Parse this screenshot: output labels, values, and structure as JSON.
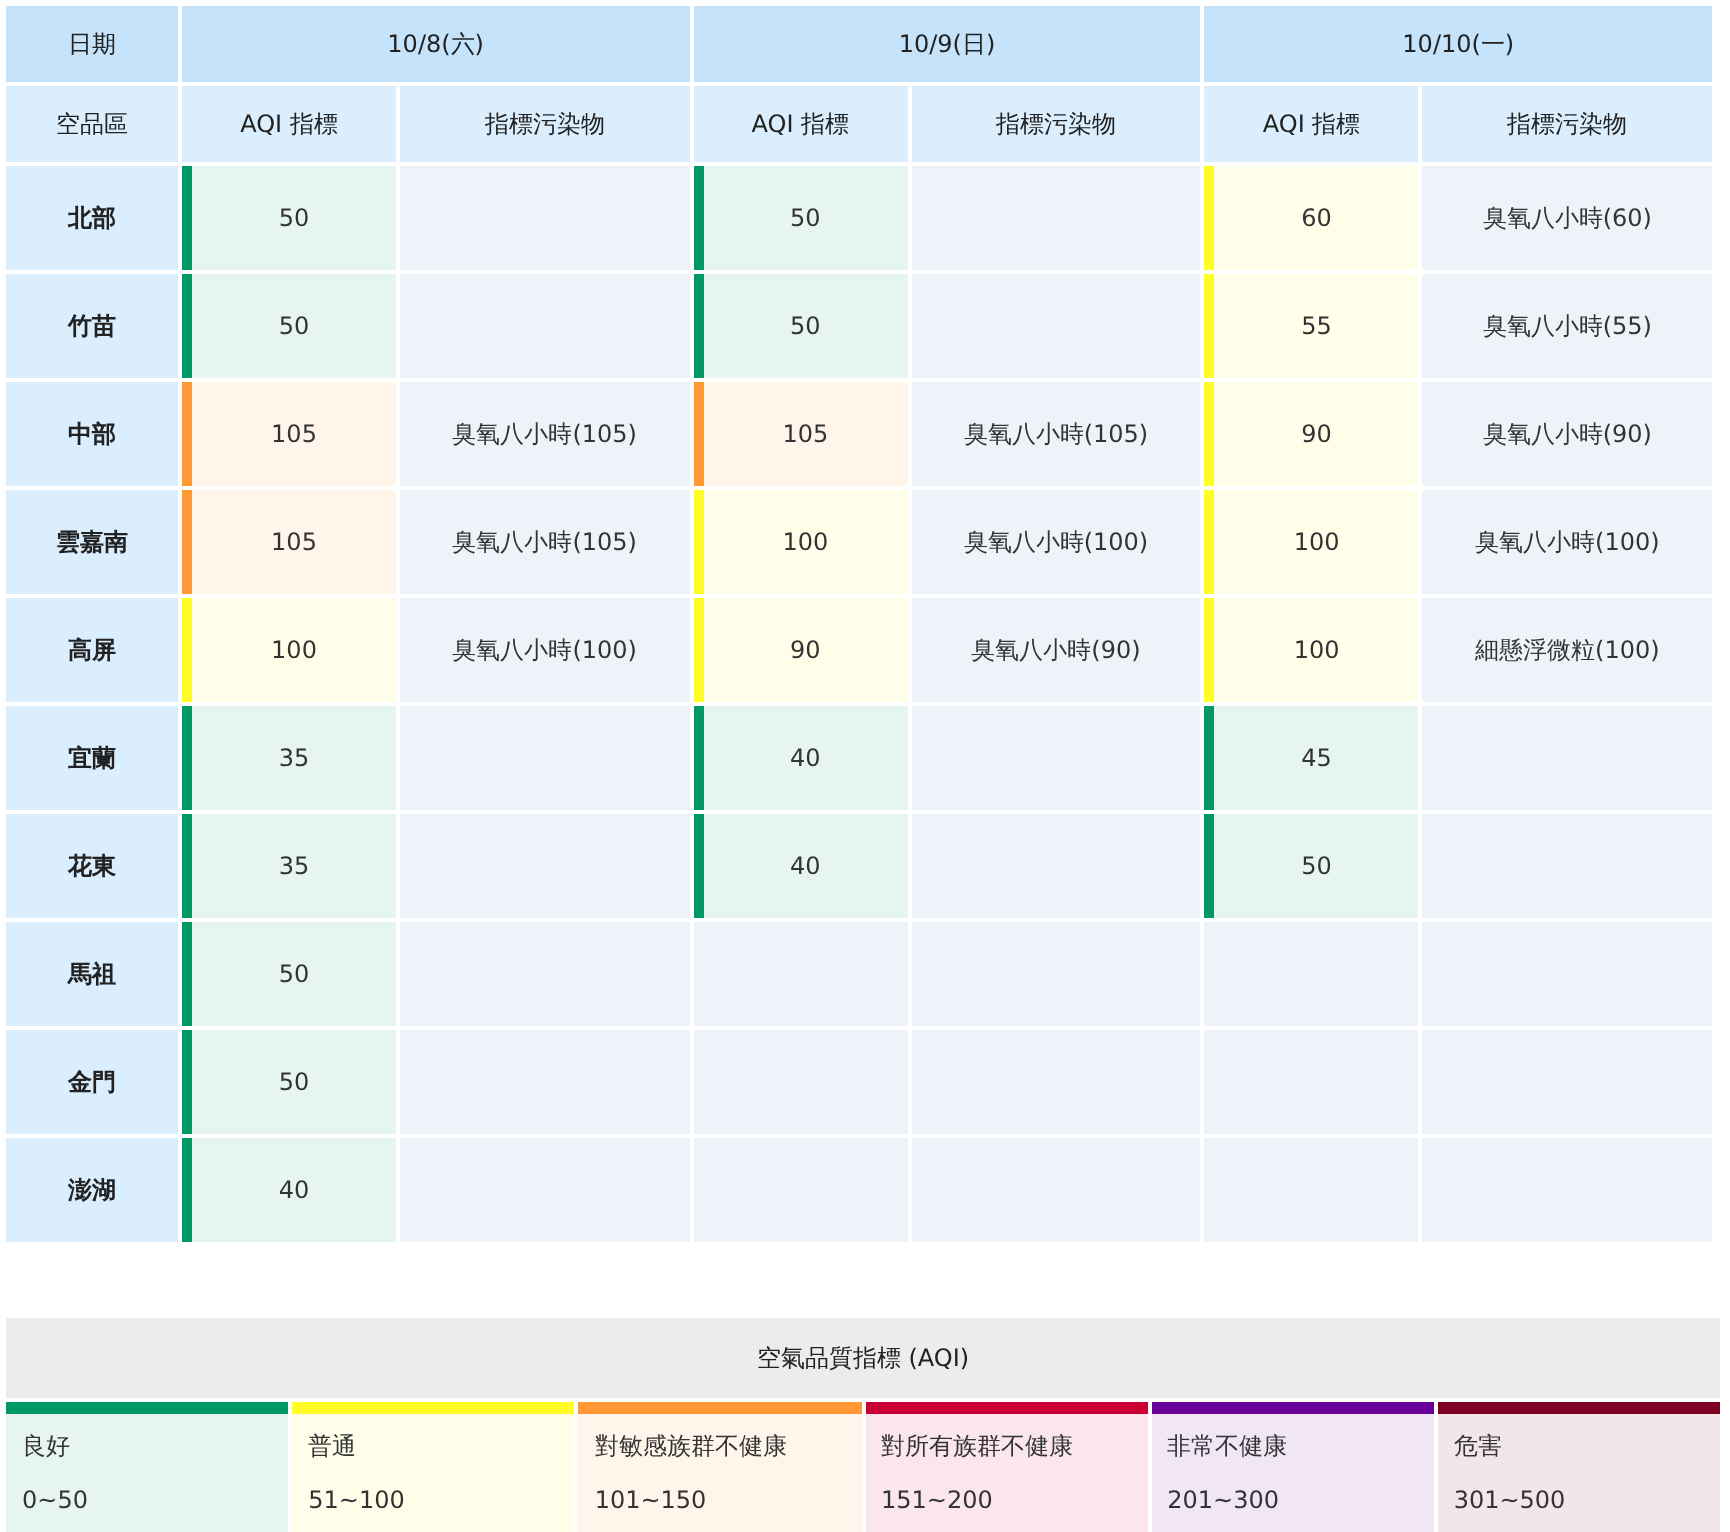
{
  "table": {
    "date_label": "日期",
    "region_label": "空品區",
    "days": [
      {
        "date": "10/8(六)",
        "aqi_label": "AQI 指標",
        "pollutant_label": "指標污染物"
      },
      {
        "date": "10/9(日)",
        "aqi_label": "AQI 指標",
        "pollutant_label": "指標污染物"
      },
      {
        "date": "10/10(一)",
        "aqi_label": "AQI 指標",
        "pollutant_label": "指標污染物"
      }
    ],
    "rows": [
      {
        "region": "北部",
        "cells": [
          {
            "aqi": "50",
            "color": "#009865"
          },
          {
            "aqi": "50",
            "color": "#009865"
          },
          {
            "aqi": "60",
            "color": "#fffb26",
            "pollutant": "臭氧八小時(60)"
          }
        ]
      },
      {
        "region": "竹苗",
        "cells": [
          {
            "aqi": "50",
            "color": "#009865"
          },
          {
            "aqi": "50",
            "color": "#009865"
          },
          {
            "aqi": "55",
            "color": "#fffb26",
            "pollutant": "臭氧八小時(55)"
          }
        ]
      },
      {
        "region": "中部",
        "cells": [
          {
            "aqi": "105",
            "color": "#ff9835",
            "pollutant": "臭氧八小時(105)"
          },
          {
            "aqi": "105",
            "color": "#ff9835",
            "pollutant": "臭氧八小時(105)"
          },
          {
            "aqi": "90",
            "color": "#fffb26",
            "pollutant": "臭氧八小時(90)"
          }
        ]
      },
      {
        "region": "雲嘉南",
        "cells": [
          {
            "aqi": "105",
            "color": "#ff9835",
            "pollutant": "臭氧八小時(105)"
          },
          {
            "aqi": "100",
            "color": "#fffb26",
            "pollutant": "臭氧八小時(100)"
          },
          {
            "aqi": "100",
            "color": "#fffb26",
            "pollutant": "臭氧八小時(100)"
          }
        ]
      },
      {
        "region": "高屏",
        "cells": [
          {
            "aqi": "100",
            "color": "#fffb26",
            "pollutant": "臭氧八小時(100)"
          },
          {
            "aqi": "90",
            "color": "#fffb26",
            "pollutant": "臭氧八小時(90)"
          },
          {
            "aqi": "100",
            "color": "#fffb26",
            "pollutant": "細懸浮微粒(100)"
          }
        ]
      },
      {
        "region": "宜蘭",
        "cells": [
          {
            "aqi": "35",
            "color": "#009865"
          },
          {
            "aqi": "40",
            "color": "#009865"
          },
          {
            "aqi": "45",
            "color": "#009865"
          }
        ]
      },
      {
        "region": "花東",
        "cells": [
          {
            "aqi": "35",
            "color": "#009865"
          },
          {
            "aqi": "40",
            "color": "#009865"
          },
          {
            "aqi": "50",
            "color": "#009865"
          }
        ]
      },
      {
        "region": "馬祖",
        "cells": [
          {
            "aqi": "50",
            "color": "#009865"
          }
        ]
      },
      {
        "region": "金門",
        "cells": [
          {
            "aqi": "50",
            "color": "#009865"
          }
        ]
      },
      {
        "region": "澎湖",
        "cells": [
          {
            "aqi": "40",
            "color": "#009865"
          }
        ]
      }
    ]
  },
  "legend": {
    "title": "空氣品質指標 (AQI)",
    "items": [
      {
        "label": "良好",
        "range": "0~50",
        "color": "#009865"
      },
      {
        "label": "普通",
        "range": "51~100",
        "color": "#fffb26"
      },
      {
        "label": "對敏感族群不健康",
        "range": "101~150",
        "color": "#ff9835"
      },
      {
        "label": "對所有族群不健康",
        "range": "151~200",
        "color": "#ca0034"
      },
      {
        "label": "非常不健康",
        "range": "201~300",
        "color": "#670099"
      },
      {
        "label": "危害",
        "range": "301~500",
        "color": "#7e0023"
      }
    ]
  }
}
